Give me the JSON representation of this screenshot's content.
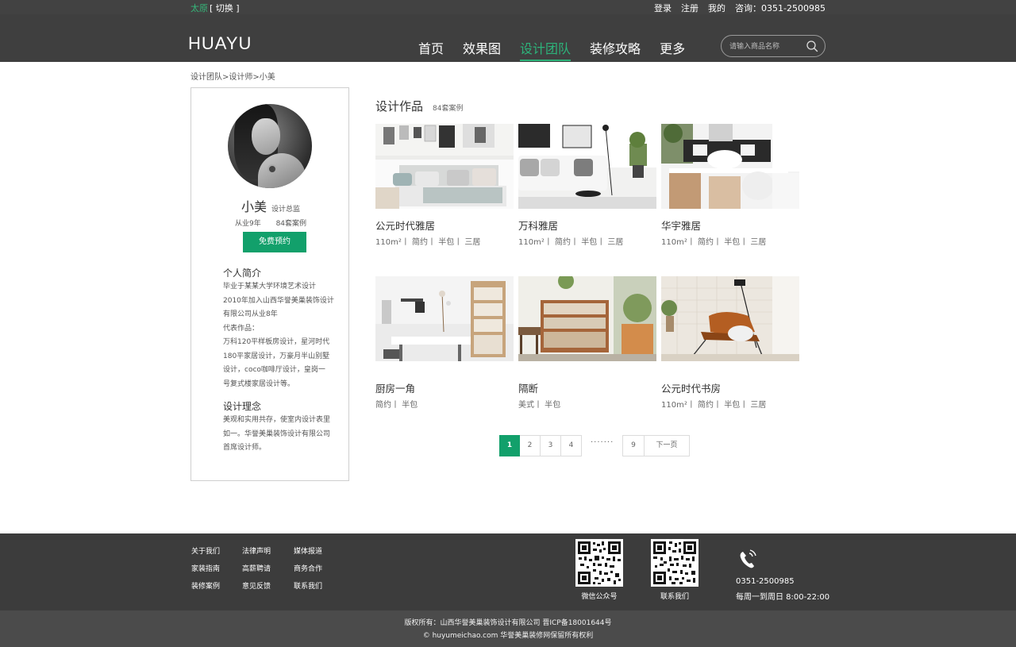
{
  "topbar": {
    "city": "太原",
    "switch": "[ 切换 ]",
    "links": [
      "登录",
      "注册",
      "我的",
      "咨询：0351-2500985"
    ]
  },
  "header": {
    "logo": "HUAYU",
    "nav": [
      "首页",
      "效果图",
      "设计团队",
      "装修攻略",
      "更多"
    ],
    "active_nav": "设计团队",
    "search_placeholder": "请输入商品名称",
    "accent_color": "#2db37a"
  },
  "breadcrumb": "设计团队>设计师>小美",
  "profile": {
    "name": "小美",
    "role": "设计总监",
    "experience": "从业9年",
    "cases": "84套案例",
    "book_button": "免费预约",
    "intro_title": "个人简介",
    "intro_lines": [
      "毕业于某某大学环境艺术设计",
      "2010年加入山西华誉美巢装饰设计",
      "有限公司从业8年",
      "代表作品：",
      "万科120平样板房设计，星河时代",
      "180平家居设计，万豪月半山别墅",
      "设计，coco咖啡厅设计，皇岗一",
      "号复式楼家居设计等。"
    ],
    "philosophy_title": "设计理念",
    "philosophy_lines": [
      "美观和实用共存，使室内设计表里",
      "如一。华誉美巢装饰设计有限公司",
      "首席设计师。"
    ]
  },
  "works": {
    "title": "设计作品",
    "count": "84套案例",
    "items": [
      {
        "title": "公元时代雅居",
        "tags": "110m²丨 简约丨 半包丨 三居"
      },
      {
        "title": "万科雅居",
        "tags": "110m²丨 简约丨 半包丨 三居"
      },
      {
        "title": "华宇雅居",
        "tags": "110m²丨 简约丨 半包丨 三居"
      },
      {
        "title": "厨房一角",
        "tags": "简约丨 半包"
      },
      {
        "title": "隔断",
        "tags": "美式丨 半包"
      },
      {
        "title": "公元时代书房",
        "tags": "110m²丨 简约丨 半包丨 三居"
      }
    ]
  },
  "pagination": {
    "pages": [
      "1",
      "2",
      "3",
      "4"
    ],
    "current": "1",
    "ellipsis": "·······",
    "last": "9",
    "next": "下一页"
  },
  "footer": {
    "links": [
      "关于我们",
      "法律声明",
      "媒体报道",
      "家装指南",
      "高薪聘请",
      "商务合作",
      "装修案例",
      "意见反馈",
      "联系我们"
    ],
    "qr1_label": "微信公众号",
    "qr2_label": "联系我们",
    "phone": "0351-2500985",
    "hours": "每周一到周日 8:00-22:00",
    "copyright_line1": "版权所有：山西华誉美巢装饰设计有限公司 晋ICP备18001644号",
    "copyright_line2": "© huyumeichao.com 华誉美巢装修网保留所有权利"
  }
}
